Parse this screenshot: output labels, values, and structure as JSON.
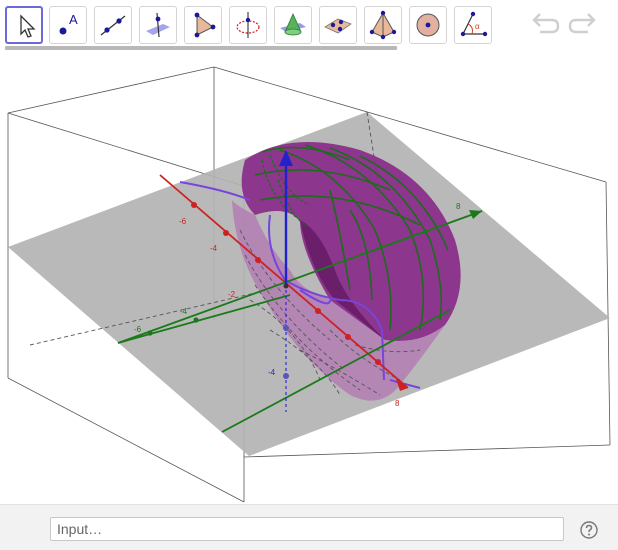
{
  "toolbar": {
    "tools": [
      {
        "name": "move",
        "selected": true
      },
      {
        "name": "point"
      },
      {
        "name": "line"
      },
      {
        "name": "perpendicular-line"
      },
      {
        "name": "polygon"
      },
      {
        "name": "circle-axis"
      },
      {
        "name": "intersect-surfaces"
      },
      {
        "name": "plane"
      },
      {
        "name": "pyramid"
      },
      {
        "name": "sphere"
      },
      {
        "name": "angle"
      }
    ],
    "point_label": "A",
    "angle_label": "α",
    "undo_icon": "undo-icon",
    "redo_icon": "redo-icon"
  },
  "graphics": {
    "x_axis_ticks": [
      "-6",
      "-4",
      "-2",
      "8"
    ],
    "y_axis_ticks": [
      "-6",
      "-4",
      "8"
    ],
    "z_axis_ticks": [
      "-4"
    ],
    "colors": {
      "x_axis": "#cc2222",
      "y_axis": "#1a7a1a",
      "z_axis": "#2222cc",
      "surface": "#8a2e8a",
      "curve": "#7744dd",
      "plane": "#b3b3b3"
    }
  },
  "input_bar": {
    "placeholder": "Input…"
  },
  "help_icon": "help-icon"
}
